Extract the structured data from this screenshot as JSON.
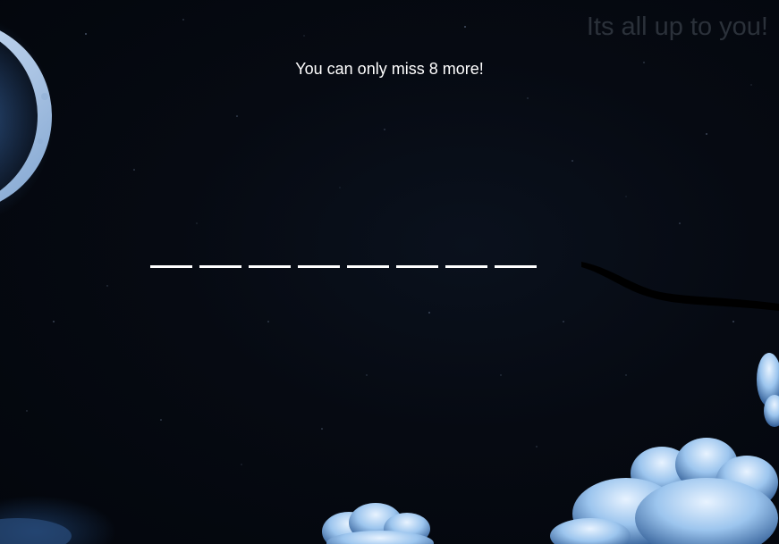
{
  "header": {
    "tagline": "Its all up to you!"
  },
  "status": {
    "misses_remaining_text": "You can only miss 8 more!",
    "misses_remaining": 8
  },
  "word": {
    "slots": [
      "",
      "",
      "",
      "",
      "",
      "",
      "",
      ""
    ]
  },
  "scene": {
    "background_color": "#05080f",
    "moon_color": "#a9c8ee",
    "cloud_color": "#bcd8f4",
    "tagline_color": "#2b313a"
  }
}
